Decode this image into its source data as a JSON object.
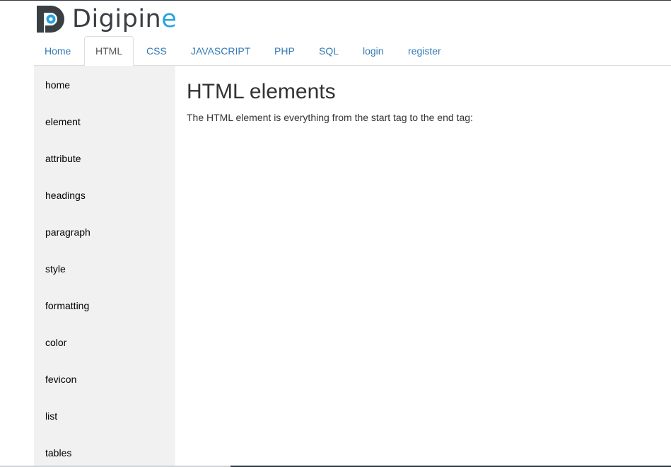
{
  "brand": {
    "name_main": "Digipin",
    "name_accent": "e"
  },
  "nav": {
    "tabs": [
      {
        "label": "Home",
        "active": false
      },
      {
        "label": "HTML",
        "active": true
      },
      {
        "label": "CSS",
        "active": false
      },
      {
        "label": "JAVASCRIPT",
        "active": false
      },
      {
        "label": "PHP",
        "active": false
      },
      {
        "label": "SQL",
        "active": false
      },
      {
        "label": "login",
        "active": false
      },
      {
        "label": "register",
        "active": false
      }
    ]
  },
  "sidebar": {
    "items": [
      {
        "label": "home"
      },
      {
        "label": "element"
      },
      {
        "label": "attribute"
      },
      {
        "label": "headings"
      },
      {
        "label": "paragraph"
      },
      {
        "label": "style"
      },
      {
        "label": "formatting"
      },
      {
        "label": "color"
      },
      {
        "label": "fevicon"
      },
      {
        "label": "list"
      },
      {
        "label": "tables"
      }
    ]
  },
  "main": {
    "title": "HTML elements",
    "text": "The HTML element is everything from the start tag to the end tag:"
  },
  "colors": {
    "link": "#337ab7",
    "brand_accent": "#27a3e0",
    "sidebar_bg": "#f1f1f1"
  }
}
